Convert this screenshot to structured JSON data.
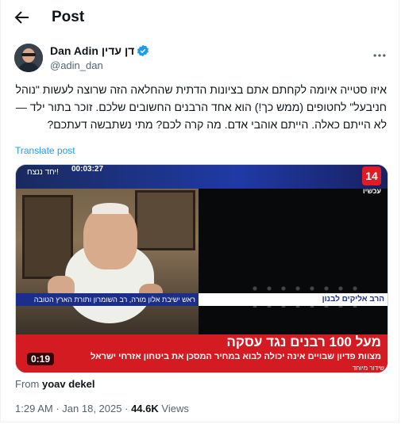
{
  "header": {
    "title": "Post"
  },
  "author": {
    "display_name": "Dan Adin דן עדין",
    "handle": "@adin_dan"
  },
  "tweet": {
    "text": "איזו סטייה איומה לקחתם אתם בציונות הדתית שהחלאה הזה שרוצה לעשות \"נוהל חניבעל\" לחטופים (ממש כך!) הוא אחד הרבנים החשובים שלכם. זוכר בתור ילד — לא הייתם כאלה. הייתם אוהבי אדם. מה קרה לכם? מתי נשתבשה דעתכם?",
    "translate_label": "Translate post"
  },
  "media": {
    "timer": "00:03:27",
    "top_text": "יחד ננצח!",
    "channel_logo": "14",
    "channel_sub": "עכשיו",
    "name_strip": "הרב אליקים לבנון",
    "role_strip": "ראש ישיבת אלון מורה, רב השומרון ותורת הארץ הטובה",
    "headline": "מעל 100 רבנים נגד עסקה",
    "subline": "מצוות פדיון שבויים אינה יכולה לבוא במחיר המסכן את ביטחון אזרחי ישראל",
    "live_label": "שידור מיוחד",
    "duration": "0:19"
  },
  "from": {
    "prefix": "From",
    "name": "yoav dekel"
  },
  "meta": {
    "time": "1:29 AM",
    "sep1": "·",
    "date": "Jan 18, 2025",
    "sep2": "·",
    "views": "44.6K",
    "views_label": "Views"
  },
  "colors": {
    "accent": "#1d9bf0",
    "banner": "#d41b22"
  }
}
